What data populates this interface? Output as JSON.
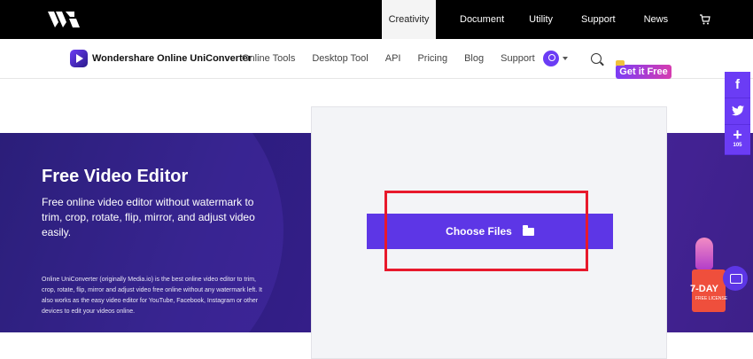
{
  "topnav": {
    "items": [
      "Creativity",
      "Document",
      "Utility",
      "Support",
      "News"
    ],
    "active": "Creativity"
  },
  "subnav": {
    "brand": "Wondershare Online UniConverter",
    "links": [
      "Online Tools",
      "Desktop Tool",
      "API",
      "Pricing",
      "Blog",
      "Support"
    ],
    "promo_badge": "Get it Free"
  },
  "hero": {
    "title": "Free Video Editor",
    "subtitle": "Free online video editor without watermark to trim, crop, rotate, flip, mirror, and adjust video easily.",
    "description": "Online UniConverter (originally Media.io) is the best online video editor to trim, crop, rotate, flip, mirror and adjust video free online without any watermark left. It also works as the easy video editor for YouTube, Facebook, Instagram or other devices to edit your videos online."
  },
  "upload": {
    "button_label": "Choose Files"
  },
  "social": {
    "facebook": "f",
    "twitter": "t",
    "share": "+",
    "share_count": "105"
  },
  "promo": {
    "days": "7-DAY",
    "license": "FREE LICENSE"
  },
  "colors": {
    "accent": "#5d36e6",
    "highlight": "#e8192c",
    "hero_bg": "#2d1d80"
  }
}
